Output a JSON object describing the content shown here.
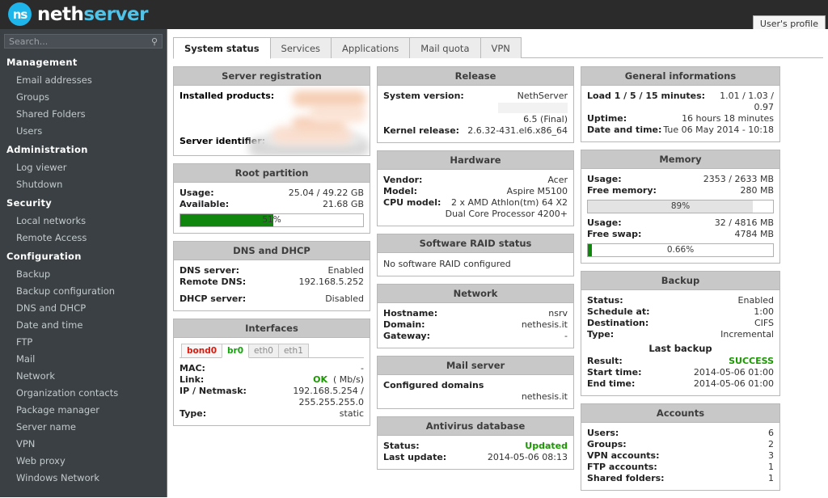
{
  "header": {
    "logo_mark": "ns",
    "logo_text_1": "neth",
    "logo_text_2": "server",
    "user_profile_label": "User's profile",
    "logo_color": "#1eb5ea"
  },
  "sidebar": {
    "search_placeholder": "Search...",
    "search_value": "",
    "groups": [
      {
        "title": "Management",
        "items": [
          "Email addresses",
          "Groups",
          "Shared Folders",
          "Users"
        ]
      },
      {
        "title": "Administration",
        "items": [
          "Log viewer",
          "Shutdown"
        ]
      },
      {
        "title": "Security",
        "items": [
          "Local networks",
          "Remote Access"
        ]
      },
      {
        "title": "Configuration",
        "items": [
          "Backup",
          "Backup configuration",
          "DNS and DHCP",
          "Date and time",
          "FTP",
          "Mail",
          "Network",
          "Organization contacts",
          "Package manager",
          "Server name",
          "VPN",
          "Web proxy",
          "Windows Network"
        ]
      }
    ]
  },
  "tabs": [
    {
      "label": "System status",
      "active": true
    },
    {
      "label": "Services",
      "active": false
    },
    {
      "label": "Applications",
      "active": false
    },
    {
      "label": "Mail quota",
      "active": false
    },
    {
      "label": "VPN",
      "active": false
    }
  ],
  "panels": {
    "server_registration": {
      "title": "Server registration",
      "installed_products_label": "Installed products:",
      "server_identifier_label": "Server identifier:"
    },
    "root_partition": {
      "title": "Root partition",
      "usage_label": "Usage:",
      "usage_value": "25.04 / 49.22 GB",
      "available_label": "Available:",
      "available_value": "21.68 GB",
      "bar_percent": "51%",
      "bar_fill": 51,
      "bar_color": "#11860f"
    },
    "dns_dhcp": {
      "title": "DNS and DHCP",
      "dns_server_label": "DNS server:",
      "dns_server_value": "Enabled",
      "remote_dns_label": "Remote DNS:",
      "remote_dns_value": "192.168.5.252",
      "dhcp_server_label": "DHCP server:",
      "dhcp_server_value": "Disabled"
    },
    "interfaces": {
      "title": "Interfaces",
      "tabs": [
        {
          "label": "bond0",
          "state": "red"
        },
        {
          "label": "br0",
          "state": "active"
        },
        {
          "label": "eth0",
          "state": "idle"
        },
        {
          "label": "eth1",
          "state": "idle"
        }
      ],
      "mac_label": "MAC:",
      "mac_value": "-",
      "link_label": "Link:",
      "link_value": "OK",
      "link_speed": "( Mb/s)",
      "ip_label": "IP / Netmask:",
      "ip_value": "192.168.5.254 / 255.255.255.0",
      "type_label": "Type:",
      "type_value": "static"
    },
    "release": {
      "title": "Release",
      "system_version_label": "System version:",
      "system_version_value": "NethServer",
      "system_version_value2": "6.5 (Final)",
      "kernel_release_label": "Kernel release:",
      "kernel_release_value": "2.6.32-431.el6.x86_64"
    },
    "hardware": {
      "title": "Hardware",
      "vendor_label": "Vendor:",
      "vendor_value": "Acer",
      "model_label": "Model:",
      "model_value": "Aspire M5100",
      "cpu_label": "CPU model:",
      "cpu_value": "2 x AMD Athlon(tm) 64 X2 Dual Core Processor 4200+"
    },
    "raid": {
      "title": "Software RAID status",
      "message": "No software RAID configured"
    },
    "network": {
      "title": "Network",
      "hostname_label": "Hostname:",
      "hostname_value": "nsrv",
      "domain_label": "Domain:",
      "domain_value": "nethesis.it",
      "gateway_label": "Gateway:",
      "gateway_value": "-"
    },
    "mail_server": {
      "title": "Mail server",
      "configured_domains_label": "Configured domains",
      "domain_value": "nethesis.it"
    },
    "antivirus": {
      "title": "Antivirus database",
      "status_label": "Status:",
      "status_value": "Updated",
      "last_update_label": "Last update:",
      "last_update_value": "2014-05-06 08:13"
    },
    "general": {
      "title": "General informations",
      "load_label": "Load 1 / 5 / 15 minutes:",
      "load_value": "1.01 / 1.03 / 0.97",
      "uptime_label": "Uptime:",
      "uptime_value": "16 hours 18 minutes",
      "datetime_label": "Date and time:",
      "datetime_value": "Tue 06 May 2014 - 10:18"
    },
    "memory": {
      "title": "Memory",
      "ram_usage_label": "Usage:",
      "ram_usage_value": "2353 / 2633 MB",
      "free_memory_label": "Free memory:",
      "free_memory_value": "280 MB",
      "ram_bar_percent": "89%",
      "ram_bar_fill": 89,
      "swap_usage_label": "Usage:",
      "swap_usage_value": "32 / 4816 MB",
      "free_swap_label": "Free swap:",
      "free_swap_value": "4784 MB",
      "swap_bar_percent": "0.66%",
      "swap_bar_fill": 2
    },
    "backup": {
      "title": "Backup",
      "status_label": "Status:",
      "status_value": "Enabled",
      "schedule_label": "Schedule at:",
      "schedule_value": "1:00",
      "destination_label": "Destination:",
      "destination_value": "CIFS",
      "type_label": "Type:",
      "type_value": "Incremental",
      "last_backup_title": "Last backup",
      "result_label": "Result:",
      "result_value": "SUCCESS",
      "start_time_label": "Start time:",
      "start_time_value": "2014-05-06 01:00",
      "end_time_label": "End time:",
      "end_time_value": "2014-05-06 01:00"
    },
    "accounts": {
      "title": "Accounts",
      "rows": [
        {
          "label": "Users:",
          "value": "6"
        },
        {
          "label": "Groups:",
          "value": "2"
        },
        {
          "label": "VPN accounts:",
          "value": "3"
        },
        {
          "label": "FTP accounts:",
          "value": "1"
        },
        {
          "label": "Shared folders:",
          "value": "1"
        }
      ]
    }
  }
}
